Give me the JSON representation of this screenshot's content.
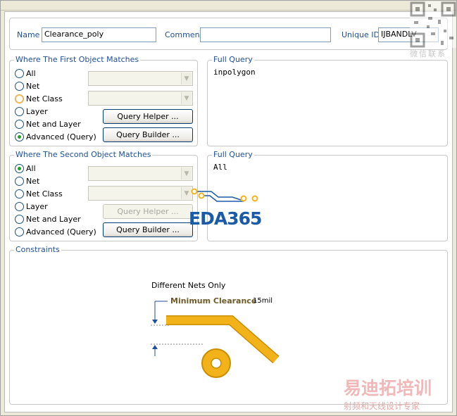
{
  "fields": {
    "name_label": "Name",
    "name_value": "Clearance_poly",
    "comment_label": "Comment",
    "comment_value": "",
    "uid_label": "Unique ID",
    "uid_value": "IJBANDLV"
  },
  "first": {
    "legend": "Where The First Object Matches",
    "options": [
      "All",
      "Net",
      "Net Class",
      "Layer",
      "Net and Layer",
      "Advanced (Query)"
    ],
    "selected": "Advanced (Query)",
    "query_helper": "Query Helper ...",
    "query_builder": "Query Builder ...",
    "full_query_legend": "Full Query",
    "full_query": "inpolygon"
  },
  "second": {
    "legend": "Where The Second Object Matches",
    "options": [
      "All",
      "Net",
      "Net Class",
      "Layer",
      "Net and Layer",
      "Advanced (Query)"
    ],
    "selected": "All",
    "query_helper": "Query Helper ...",
    "query_builder": "Query Builder ...",
    "full_query_legend": "Full Query",
    "full_query": "All"
  },
  "constraints": {
    "legend": "Constraints",
    "net_scope": "Different Nets Only",
    "min_clearance_label": "Minimum Clearance",
    "min_clearance_value": "15mil"
  },
  "watermarks": {
    "eda": "EDA365",
    "cn_title": "易迪拓培训",
    "cn_sub": "射频和天线设计专家",
    "qr_label": "微信联系"
  },
  "colors": {
    "label_blue": "#1f4e9a",
    "track_gold": "#f2b31a",
    "selected_green": "#21a121"
  }
}
